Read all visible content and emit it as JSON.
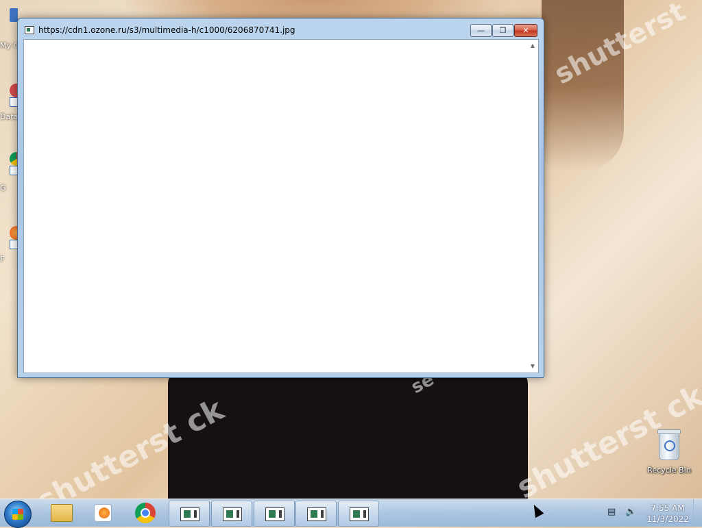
{
  "window": {
    "title": "https://cdn1.ozone.ru/s3/multimedia-h/c1000/6206870741.jpg"
  },
  "desktop": {
    "partial_icons": [
      {
        "label": "My C"
      },
      {
        "label": "Data"
      },
      {
        "label": "G"
      },
      {
        "label": "F"
      }
    ],
    "watermarks": [
      "shutterst ck",
      "shutterst ck",
      "se",
      "shutterst"
    ],
    "recycle_bin": {
      "label": "Recycle Bin"
    }
  },
  "taskbar": {
    "pinned": [
      "start-orb",
      "windows-explorer-icon",
      "media-player-icon",
      "chrome-icon"
    ],
    "open_windows": 5,
    "tray": {
      "icons": [
        "network-icon",
        "volume-icon"
      ],
      "time": "7:55 AM",
      "date": "11/3/2022"
    }
  }
}
